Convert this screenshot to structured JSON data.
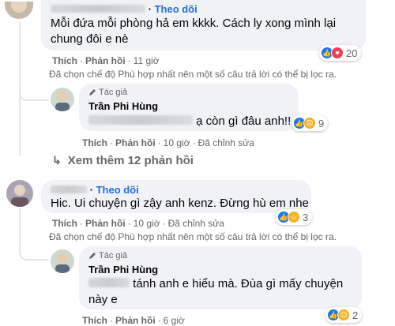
{
  "comments": [
    {
      "follow_label": "Theo dõi",
      "text_line1": "Mỗi đứa mỗi phòng hả em kkkk. Cách ly xong mình lại",
      "text_line2": "chung đôi e nè",
      "like_label": "Thích",
      "reply_label": "Phản hồi",
      "time": "11 giờ",
      "reaction_count": "20"
    },
    {
      "author_badge": "Tác giả",
      "name": "Trần Phi Hùng",
      "text_visible": "ạ còn gì đâu anh!!",
      "like_label": "Thích",
      "reply_label": "Phản hồi",
      "time": "10 giờ",
      "edited_label": "Đã chỉnh sửa",
      "reaction_count": "9"
    },
    {
      "follow_label": "Theo dõi",
      "text": "Hic. Ui chuyện gì zậy anh kenz. Đừng hù em nhe",
      "like_label": "Thích",
      "reply_label": "Phản hồi",
      "time": "10 giờ",
      "edited_label": "Đã chỉnh sửa",
      "reaction_count": "3"
    },
    {
      "author_badge": "Tác giả",
      "name": "Trần Phi Hùng",
      "text_line1": "tánh anh e hiểu mà. Đùa gì mấy chuyện",
      "text_line2": "này e",
      "like_label": "Thích",
      "reply_label": "Phản hồi",
      "time": "6 giờ",
      "reaction_count": "2"
    }
  ],
  "filter_notice": "Đã chọn chế độ Phù hợp nhất nên một số câu trả lời có thể bị lọc ra.",
  "see_more": "Xem thêm 12 phản hồi",
  "colors": {
    "link": "#216fdb",
    "bubble": "#f0f2f5",
    "meta": "#65676b",
    "like": "#1877f2",
    "love": "#f33e58",
    "haha": "#f7b125"
  }
}
